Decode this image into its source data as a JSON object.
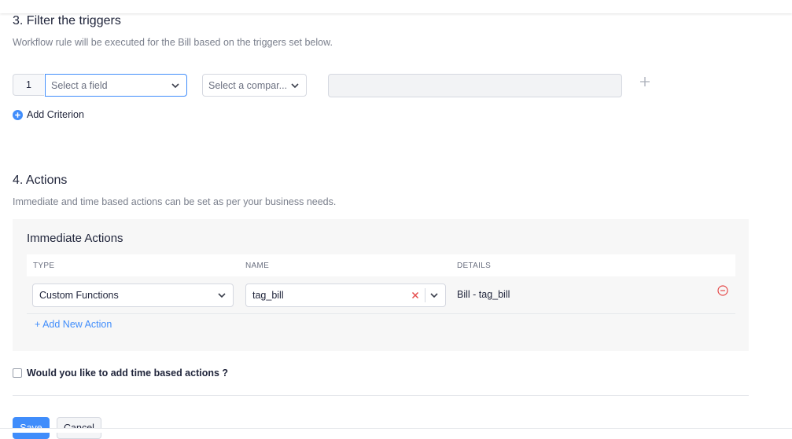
{
  "filter": {
    "heading": "3. Filter the triggers",
    "description": "Workflow rule will be executed for the Bill based on the triggers set below.",
    "criterion_number": "1",
    "field_select": "Select a field",
    "comparator_select": "Select a compar...",
    "value": "",
    "add_criterion": "Add Criterion"
  },
  "actions": {
    "heading": "4. Actions",
    "description": "Immediate and time based actions can be set as per your business needs.",
    "immediate_title": "Immediate Actions",
    "columns": [
      "TYPE",
      "NAME",
      "DETAILS"
    ],
    "rows": [
      {
        "type": "Custom Functions",
        "name": "tag_bill",
        "details": "Bill - tag_bill"
      }
    ],
    "add_new_action": "+ Add New Action",
    "time_based_label": "Would you like to add time based actions ?"
  },
  "buttons": {
    "save": "Save",
    "cancel": "Cancel"
  },
  "colors": {
    "accent": "#408dfb",
    "danger": "#e54b4b",
    "panel": "#f7f7f7"
  }
}
